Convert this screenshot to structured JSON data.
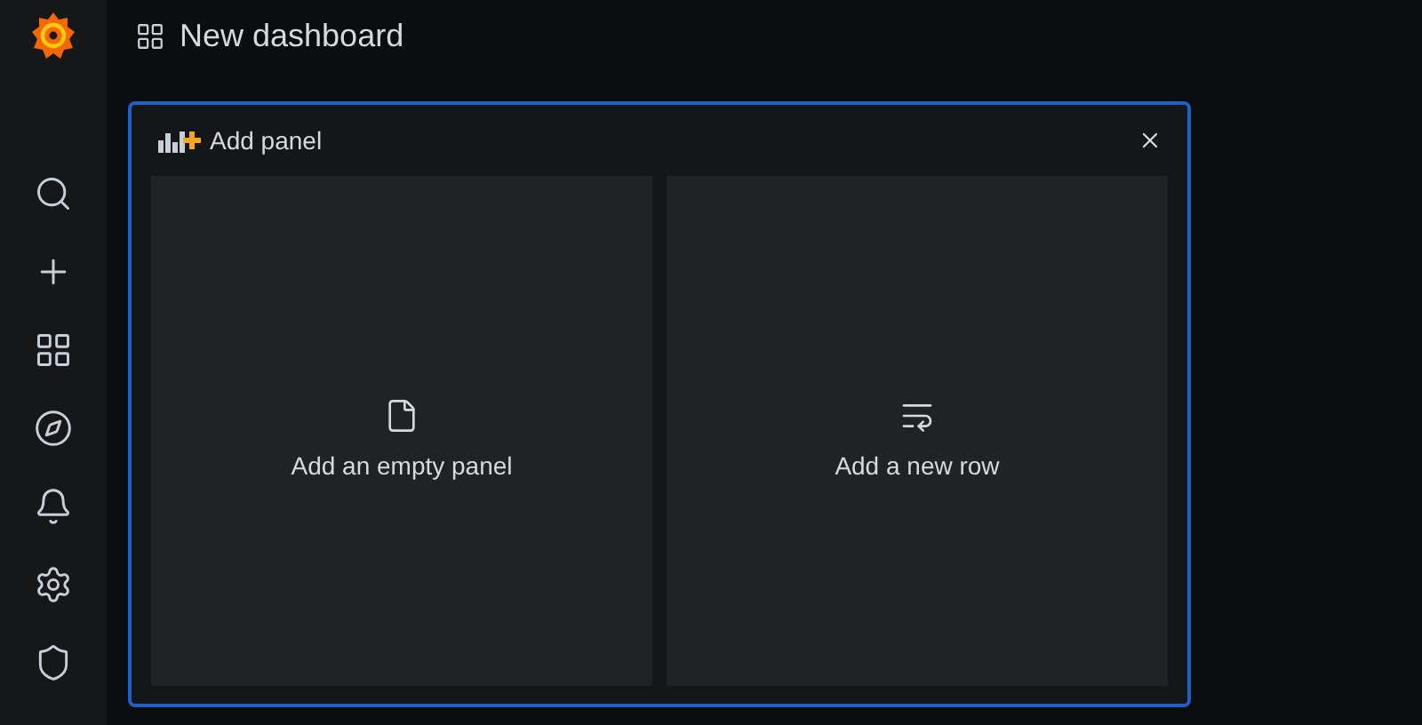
{
  "dashboard": {
    "title": "New dashboard"
  },
  "add_panel": {
    "title": "Add panel",
    "options": [
      {
        "kind": "empty",
        "label": "Add an empty panel"
      },
      {
        "kind": "row",
        "label": "Add a new row"
      }
    ]
  }
}
